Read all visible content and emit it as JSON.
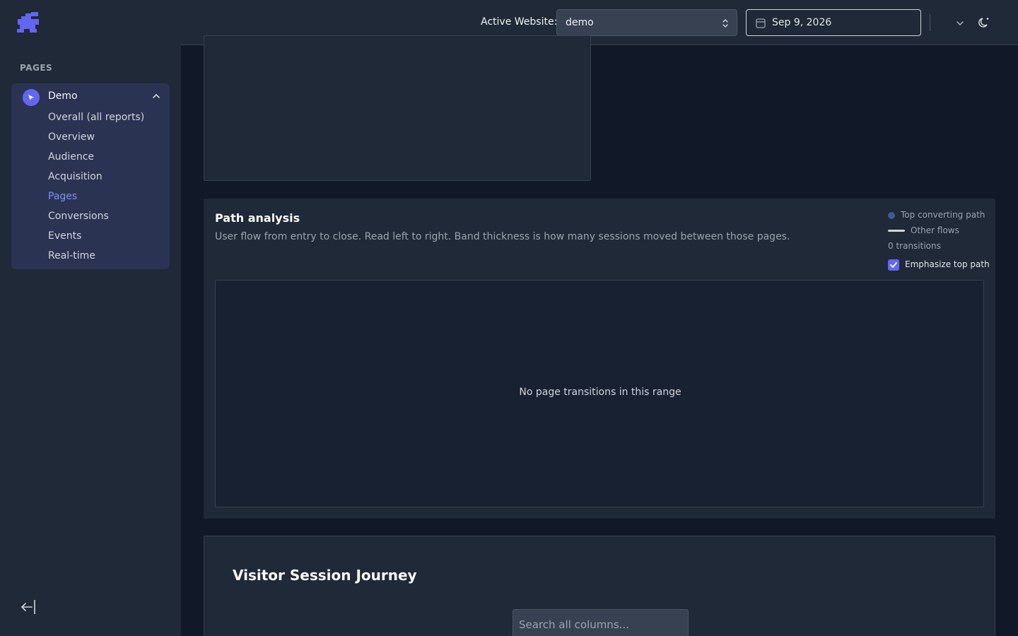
{
  "sidebar": {
    "section_label": "PAGES",
    "site": {
      "name": "Demo"
    },
    "items": [
      {
        "label": "Overall (all reports)",
        "active": false
      },
      {
        "label": "Overview",
        "active": false
      },
      {
        "label": "Audience",
        "active": false
      },
      {
        "label": "Acquisition",
        "active": false
      },
      {
        "label": "Pages",
        "active": true
      },
      {
        "label": "Conversions",
        "active": false
      },
      {
        "label": "Events",
        "active": false
      },
      {
        "label": "Real-time",
        "active": false
      }
    ]
  },
  "topbar": {
    "active_website_label": "Active Website:",
    "website_value": "demo",
    "date_value": "Sep 9, 2026"
  },
  "path_analysis": {
    "title": "Path analysis",
    "description": "User flow from entry to close. Read left to right. Band thickness is how many sessions moved between those pages.",
    "legend_top": "Top converting path",
    "legend_other": "Other flows",
    "transitions": "0 transitions",
    "emphasize_label": "Emphasize top path",
    "emphasize_checked": true,
    "empty_message": "No page transitions in this range"
  },
  "journey": {
    "title": "Visitor Session Journey",
    "search_placeholder": "Search all columns..."
  },
  "colors": {
    "accent": "#6366f1",
    "active_nav": "#818cf8",
    "top_path": "#3b5a9a"
  }
}
